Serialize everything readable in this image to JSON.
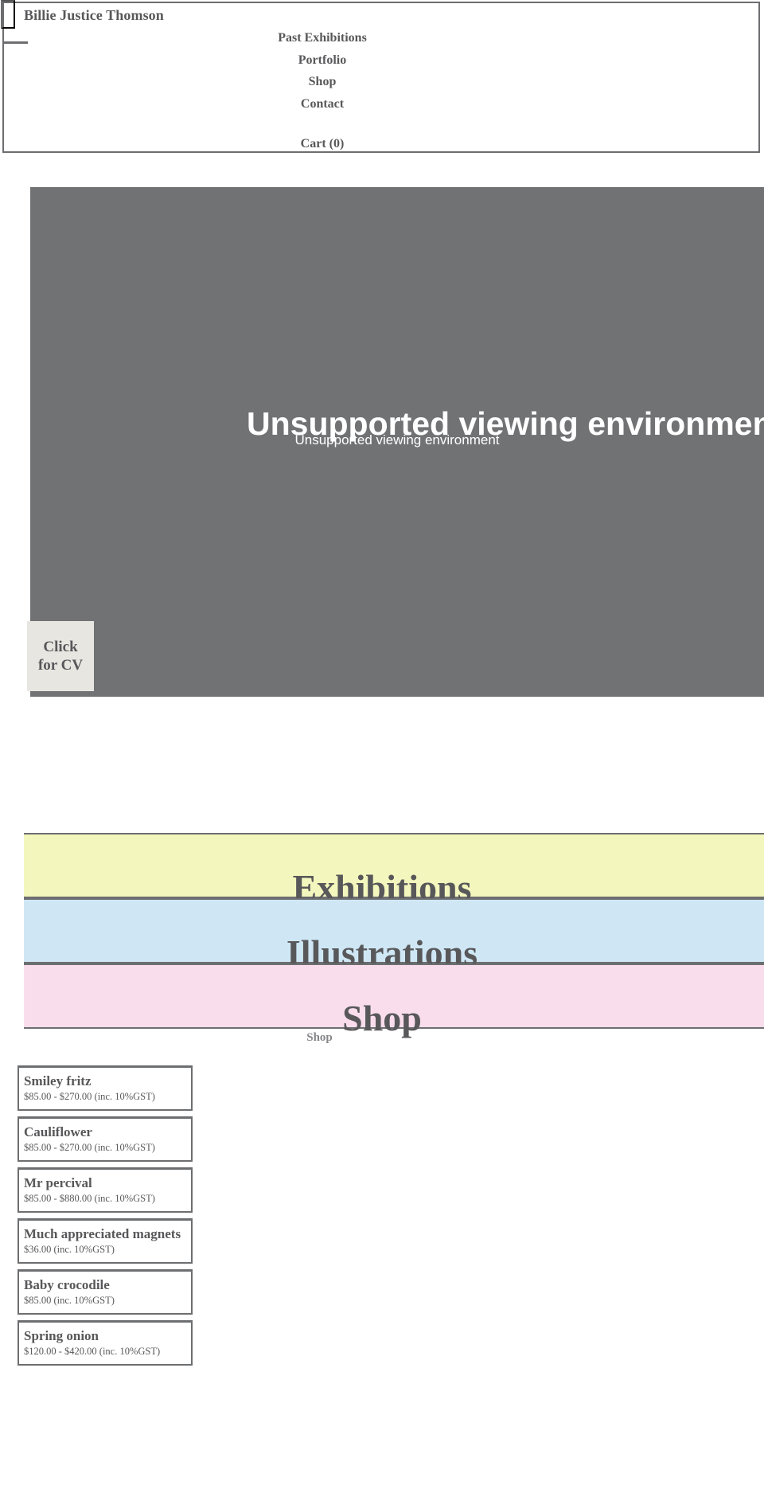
{
  "header": {
    "brand": "Billie Justice Thomson",
    "menu_toggle_label": "",
    "nav": [
      {
        "label": "Past Exhibitions",
        "name": "nav-past-exhibitions"
      },
      {
        "label": "Portfolio",
        "name": "nav-portfolio"
      },
      {
        "label": "Shop",
        "name": "nav-shop"
      },
      {
        "label": "Contact",
        "name": "nav-contact"
      }
    ],
    "cart": {
      "label": "Cart (0)",
      "count": 0
    }
  },
  "hero": {
    "headline": "Unsupported viewing environment",
    "subline": "Unsupported viewing environment",
    "background_color": "#717274",
    "cv_button": "Click for CV"
  },
  "bands": [
    {
      "title": "Exhibitions",
      "color": "#f4f7bd"
    },
    {
      "title": "Illustrations",
      "color": "#cfe7f5"
    },
    {
      "title": "Shop",
      "color": "#fadded"
    }
  ],
  "shop": {
    "heading": "Shop",
    "products": [
      {
        "name": "Smiley fritz",
        "price": "$85.00 - $270.00 (inc. 10%GST)"
      },
      {
        "name": "Cauliflower",
        "price": "$85.00 - $270.00 (inc. 10%GST)"
      },
      {
        "name": "Mr percival",
        "price": "$85.00 - $880.00 (inc. 10%GST)"
      },
      {
        "name": "Much appreciated magnets",
        "price": "$36.00 (inc. 10%GST)"
      },
      {
        "name": "Baby crocodile",
        "price": "$85.00 (inc. 10%GST)"
      },
      {
        "name": "Spring onion",
        "price": "$120.00 - $420.00 (inc. 10%GST)"
      }
    ]
  },
  "theme": {
    "text_color": "#58585a",
    "border_color": "#6d6e70",
    "muted_text": "#86878a",
    "button_bg": "#e7e6e1"
  }
}
